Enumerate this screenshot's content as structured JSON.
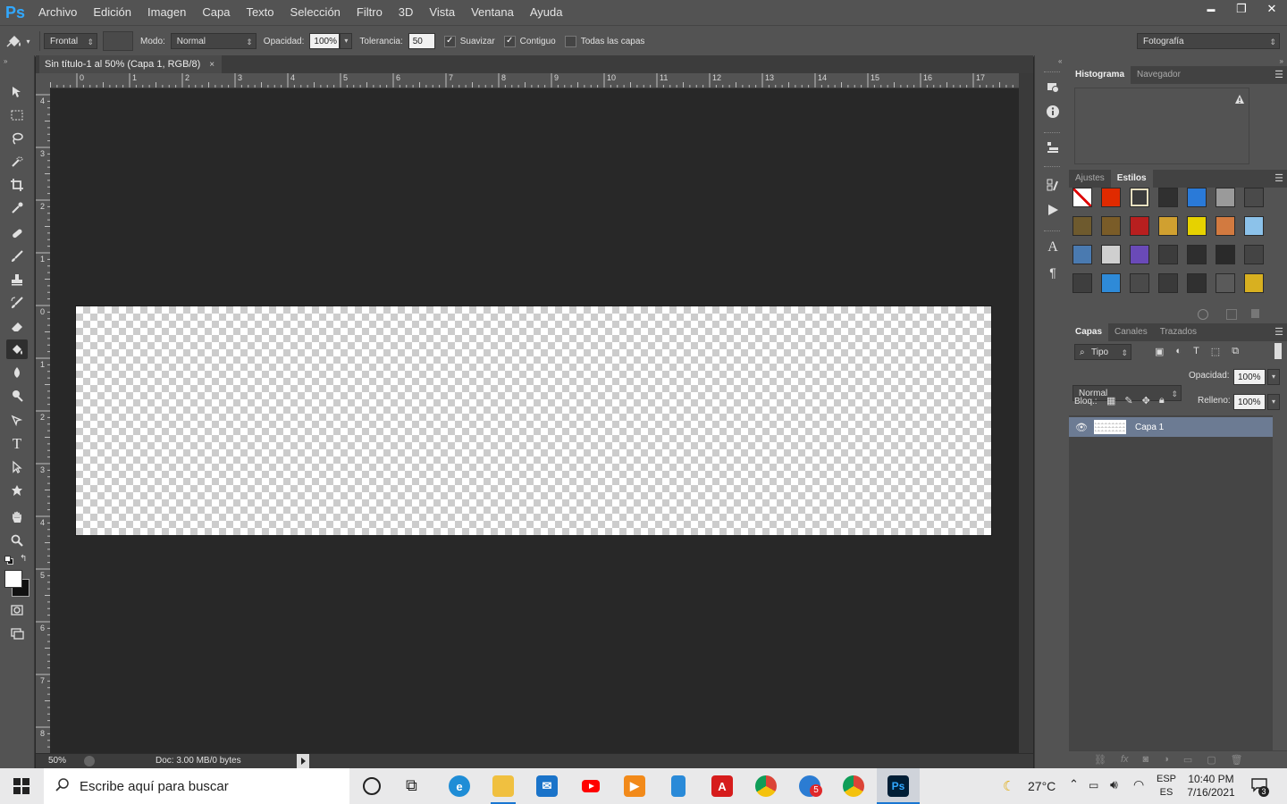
{
  "app": {
    "logo": "Ps"
  },
  "menu": [
    "Archivo",
    "Edición",
    "Imagen",
    "Capa",
    "Texto",
    "Selección",
    "Filtro",
    "3D",
    "Vista",
    "Ventana",
    "Ayuda"
  ],
  "window_controls": {
    "minimize": "▬",
    "restore": "❐",
    "close": "✕"
  },
  "options": {
    "fill_source": "Frontal",
    "mode_label": "Modo:",
    "mode_value": "Normal",
    "opacity_label": "Opacidad:",
    "opacity_value": "100%",
    "tolerance_label": "Tolerancia:",
    "tolerance_value": "50",
    "antialias_label": "Suavizar",
    "antialias_checked": true,
    "contiguous_label": "Contiguo",
    "contiguous_checked": true,
    "all_layers_label": "Todas las capas",
    "all_layers_checked": false,
    "workspace": "Fotografía"
  },
  "document": {
    "tab_title": "Sin título-1 al 50% (Capa 1, RGB/8)",
    "close": "×"
  },
  "rulers": {
    "horizontal": [
      "0",
      "1",
      "2",
      "3",
      "4",
      "5",
      "6",
      "7",
      "8",
      "9",
      "10",
      "11",
      "12",
      "13",
      "14",
      "15",
      "16",
      "17"
    ],
    "vertical": [
      "4",
      "3",
      "2",
      "1",
      "0",
      "1",
      "2",
      "3",
      "4",
      "5",
      "6",
      "7",
      "8"
    ]
  },
  "status": {
    "zoom": "50%",
    "doc_info": "Doc: 3.00 MB/0 bytes"
  },
  "panels": {
    "top_tabs": [
      "Histograma",
      "Navegador"
    ],
    "mid_tabs": [
      "Ajustes",
      "Estilos"
    ],
    "layer_tabs": [
      "Capas",
      "Canales",
      "Trazados"
    ],
    "filter_label": "Tipo",
    "blend_mode": "Normal",
    "opacity_label": "Opacidad:",
    "opacity_value": "100%",
    "lock_label": "Bloq.:",
    "fill_label": "Relleno:",
    "fill_value": "100%",
    "layer_name": "Capa 1",
    "style_colors": [
      "#ffffff",
      "#e02a00",
      "#3c3c3c",
      "#303030",
      "#2a7ad8",
      "#9a9a9a",
      "#4a4a4a",
      "#6e5a2e",
      "#7a5c28",
      "#b81f1f",
      "#d0a030",
      "#e6d200",
      "#d27a40",
      "#8cc2ea",
      "#4a7ab0",
      "#cfcfcf",
      "#6a4ab8",
      "#3c3c3c",
      "#2e2e2e",
      "#2a2a2a",
      "#444444",
      "#3e3e3e",
      "#2e8ad8",
      "#4a4a4a",
      "#3a3a3a",
      "#303030",
      "#5a5a5a",
      "#d8b020"
    ]
  },
  "taskbar": {
    "search_placeholder": "Escribe aquí para buscar",
    "weather": "27°C",
    "lang_top": "ESP",
    "lang_bottom": "ES",
    "time": "10:40 PM",
    "date": "7/16/2021",
    "notifications": "3",
    "badge": "5"
  }
}
